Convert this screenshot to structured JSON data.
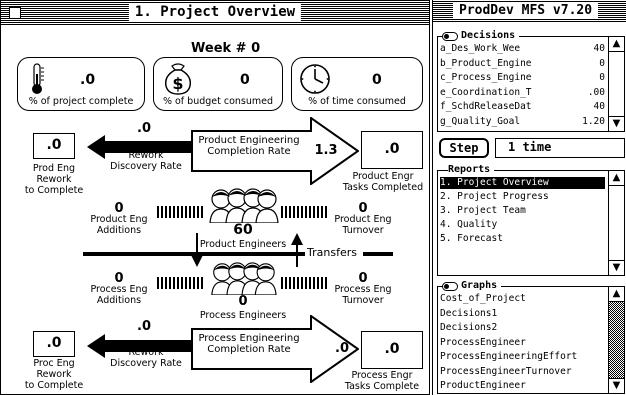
{
  "left_window": {
    "title": "1. Project Overview",
    "week_label": "Week # 0",
    "gauges": [
      {
        "value": ".0",
        "caption": "% of project complete",
        "icon": "thermometer-icon"
      },
      {
        "value": "0",
        "caption": "% of budget consumed",
        "icon": "money-bag-icon",
        "icon_text": "$"
      },
      {
        "value": "0",
        "caption": "% of time consumed",
        "icon": "clock-icon"
      }
    ],
    "product": {
      "rework_to_complete_value": ".0",
      "rework_to_complete_label": "Prod Eng\nRework\nto Complete",
      "rework_rate_value": ".0",
      "rework_rate_label": "Rework\nDiscovery Rate",
      "completion_rate_label": "Product Engineering\nCompletion Rate",
      "completion_rate_value": "1.3",
      "tasks_completed_value": ".0",
      "tasks_completed_label": "Product Engr\nTasks Completed",
      "additions_value": "0",
      "additions_label": "Product Eng\nAdditions",
      "engineers_value": "60",
      "engineers_label": "Product Engineers",
      "turnover_value": "0",
      "turnover_label": "Product Eng\nTurnover"
    },
    "transfers_label": "Transfers",
    "process": {
      "additions_value": "0",
      "additions_label": "Process Eng\nAdditions",
      "engineers_value": "0",
      "engineers_label": "Process Engineers",
      "turnover_value": "0",
      "turnover_label": "Process Eng\nTurnover",
      "rework_to_complete_value": ".0",
      "rework_to_complete_label": "Proc Eng\nRework\nto Complete",
      "rework_rate_value": ".0",
      "rework_rate_label": "Rework\nDiscovery Rate",
      "completion_rate_label": "Process Engineering\nCompletion Rate",
      "completion_rate_value": ".0",
      "tasks_completed_value": ".0",
      "tasks_completed_label": "Process Engr\nTasks Complete"
    }
  },
  "right_window": {
    "title": "ProdDev MFS v7.20",
    "decisions": {
      "header": "Decisions",
      "rows": [
        {
          "name": "a_Des_Work_Wee",
          "value": "40"
        },
        {
          "name": "b_Product_Engine",
          "value": "0"
        },
        {
          "name": "c_Process_Engine",
          "value": "0"
        },
        {
          "name": "e_Coordination_T",
          "value": ".00"
        },
        {
          "name": "f_SchdReleaseDat",
          "value": "40"
        },
        {
          "name": "g_Quality_Goal",
          "value": "1.20"
        }
      ]
    },
    "step_label": "Step",
    "step_value": "1 time",
    "reports": {
      "header": "Reports",
      "items": [
        "1. Project Overview",
        "2. Project Progress",
        "3. Project Team",
        "4. Quality",
        "5. Forecast"
      ],
      "selected_index": 0
    },
    "graphs": {
      "header": "Graphs",
      "items": [
        "Cost_of_Project",
        "Decisions1",
        "Decisions2",
        "ProcessEngineer",
        "ProcessEngineeringEffort",
        "ProcessEngineerTurnover",
        "ProductEngineer"
      ]
    }
  }
}
